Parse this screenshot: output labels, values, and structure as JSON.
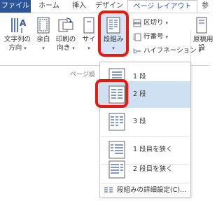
{
  "tabs": [
    {
      "label": "ファイル"
    },
    {
      "label": "ホーム"
    },
    {
      "label": "挿入"
    },
    {
      "label": "デザイン"
    },
    {
      "label": "ページ レイアウト"
    },
    {
      "label": "参"
    }
  ],
  "ribbon": {
    "text_direction": {
      "line1": "文字列の",
      "line2": "方向"
    },
    "margins": {
      "line1": "余白"
    },
    "orientation": {
      "line1": "印刷の",
      "line2": "向き"
    },
    "size": {
      "line1": "サイ"
    },
    "columns": {
      "line1": "段組み"
    },
    "breaks": "区切り",
    "line_numbers": "行番号",
    "hyphenation": "ハイフネーション",
    "manuscript": {
      "line1": "原稿用",
      "line2": "設"
    },
    "group_label": "ページ設"
  },
  "menu": {
    "items": [
      {
        "label": "1 段",
        "selected": false
      },
      {
        "label": "2 段",
        "selected": true
      },
      {
        "label": "3 段",
        "selected": false
      },
      {
        "label": "1 段目を狭く",
        "selected": false
      },
      {
        "label": "2 段目を狭く",
        "selected": false
      }
    ],
    "more": "段組みの詳細設定(C)..."
  },
  "colors": {
    "accent": "#2b579a",
    "highlight": "#e8190f",
    "selected": "#cfe0f3"
  }
}
